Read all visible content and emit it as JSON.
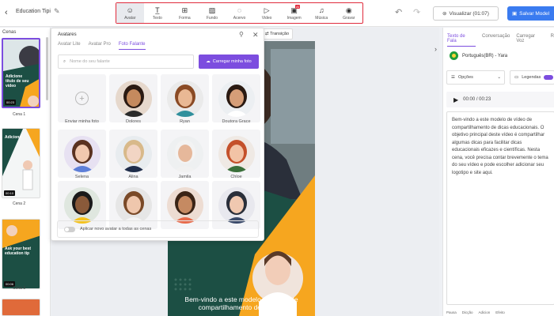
{
  "project": {
    "back_icon": "chevron-left-icon",
    "name": "Education Tipi",
    "edit_icon": "pencil-icon"
  },
  "toolbar": {
    "tools": [
      {
        "label": "Avatar",
        "icon": "avatar-icon",
        "glyph": "☺"
      },
      {
        "label": "Texto",
        "icon": "text-icon",
        "glyph": "T̲"
      },
      {
        "label": "Forma",
        "icon": "shapes-icon",
        "glyph": "⊞"
      },
      {
        "label": "Fundo",
        "icon": "background-icon",
        "glyph": "▨"
      },
      {
        "label": "Acervo",
        "icon": "library-icon",
        "glyph": "◌"
      },
      {
        "label": "Video",
        "icon": "video-icon",
        "glyph": "▷"
      },
      {
        "label": "Imagem",
        "icon": "image-icon",
        "glyph": "▣",
        "badge": "AI"
      },
      {
        "label": "Música",
        "icon": "music-icon",
        "glyph": "♫"
      },
      {
        "label": "Gravar",
        "icon": "record-icon",
        "glyph": "◉"
      }
    ],
    "undo_icon": "undo-icon",
    "redo_icon": "redo-icon",
    "preview_label": "Visualizar (01:07)",
    "save_label": "Salvar Model"
  },
  "scenes": {
    "title": "Cenas",
    "items": [
      {
        "label": "Cena 1",
        "duration": "00:23",
        "title": "Adicione título de seu vídeo"
      },
      {
        "label": "Cena 2",
        "duration": "00:10",
        "title": "Adicione"
      },
      {
        "label": "Cena 3",
        "duration": "00:06",
        "title": "Ask your best education tip"
      }
    ]
  },
  "transition_label": "Transição",
  "avatar_panel": {
    "title": "Avatares",
    "tabs": [
      "Avatar Lite",
      "Avatar Pro",
      "Foto Falante"
    ],
    "active_tab": 2,
    "search_placeholder": "Nome do seu falante",
    "upload_label": "Carregar minha foto",
    "avatars": [
      {
        "name": "Enviar minha foto"
      },
      {
        "name": "Dolores",
        "skin": "#c58a5e",
        "hair": "#2b1a12",
        "cloth": "#2a2a2a",
        "bg": "#e6d8cc"
      },
      {
        "name": "Ryan",
        "skin": "#e9b894",
        "hair": "#8a4a24",
        "cloth": "#2f8f9c",
        "bg": "#eaeaea"
      },
      {
        "name": "Doutora Grace",
        "skin": "#d69e78",
        "hair": "#2a1a12",
        "cloth": "#ffffff",
        "bg": "#eceff2"
      },
      {
        "name": "Selena",
        "skin": "#f1c8ae",
        "hair": "#5a3220",
        "cloth": "#5e7fd8",
        "bg": "#e7e1f2"
      },
      {
        "name": "Alina",
        "skin": "#f2d5c4",
        "hair": "#d8b98a",
        "cloth": "#1f2d4a",
        "bg": "#e8ecef"
      },
      {
        "name": "Jamila",
        "skin": "#e6b89b",
        "hair": "#f3f3f3",
        "cloth": "#f1f1f1",
        "bg": "#eef0f1"
      },
      {
        "name": "Chloe",
        "skin": "#f2c3a6",
        "hair": "#c4502a",
        "cloth": "#3a6f3a",
        "bg": "#efe9e4"
      },
      {
        "name": "",
        "skin": "#8a5a3a",
        "hair": "#1a1a1a",
        "cloth": "#f4c21e",
        "bg": "#dfe7df"
      },
      {
        "name": "",
        "skin": "#efc7ad",
        "hair": "#7a4a28",
        "cloth": "#f4f4f4",
        "bg": "#e6e6e6"
      },
      {
        "name": "",
        "skin": "#c58a62",
        "hair": "#3a2416",
        "cloth": "#e86a4a",
        "bg": "#eddcd2"
      },
      {
        "name": "",
        "skin": "#f0c8b0",
        "hair": "#2a2f3a",
        "cloth": "#3a4a6a",
        "bg": "#e8e8ee"
      }
    ],
    "apply_label": "Aplicar novo avatar a todas as cenas"
  },
  "canvas": {
    "caption": "Bem-vindo a este modelo de vídeo de compartilhamento de dicas..."
  },
  "right_panel": {
    "tabs": [
      "Texto de Fala",
      "Conversação",
      "Carregar Voz",
      "R"
    ],
    "active_tab": 0,
    "language": "Português(BR) - Yara",
    "options_label": "Opções",
    "legend_label": "Legendas",
    "time": "00:00 / 00:23",
    "script": "Bem-vindo a este modelo de vídeo de compartilhamento de dicas educacionais. O objetivo principal deste vídeo é compartilhar algumas dicas para facilitar dicas educacionais eficazes e científicas. Nesta cena, você precisa contar brevemente o tema do seu vídeo e pode escolher adicionar seu logotipo e site aqui.",
    "bottom": [
      "Pausa",
      "Dicção",
      "Adicion",
      "Efeito"
    ]
  },
  "colors": {
    "accent": "#7c4ddf",
    "save": "#3a7bf0",
    "toolbar_outline": "#e02b3c",
    "slide_green": "#1c4f44",
    "slide_orange": "#f6a61f"
  }
}
